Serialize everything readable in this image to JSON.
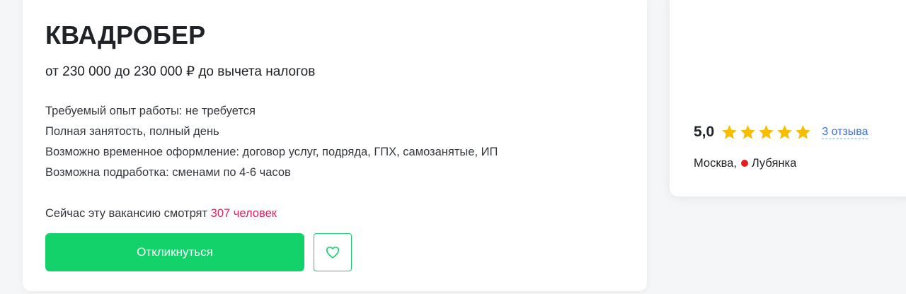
{
  "vacancy": {
    "title": "КВАДРОБЕР",
    "salary": "от 230 000 до 230 000 ₽ до вычета налогов",
    "conditions": [
      "Требуемый опыт работы: не требуется",
      "Полная занятость, полный день",
      "Возможно временное оформление: договор услуг, подряда, ГПХ, самозанятые, ИП",
      "Возможна подработка: сменами по 4-6 часов"
    ],
    "viewers_prefix": "Сейчас эту вакансию смотрят",
    "viewers_count": "307 человек",
    "respond_label": "Откликнуться",
    "favorite_icon": "heart-icon"
  },
  "employer": {
    "rating": "5,0",
    "stars": 5,
    "reviews_link": "3 отзыва",
    "city": "Москва,",
    "metro": "Лубянка",
    "metro_color": "#e41e1e"
  },
  "colors": {
    "accent_green": "#13d26a",
    "highlight_pink": "#e0245e",
    "star_yellow": "#f7bd00",
    "link_blue": "#3d6fe0"
  }
}
